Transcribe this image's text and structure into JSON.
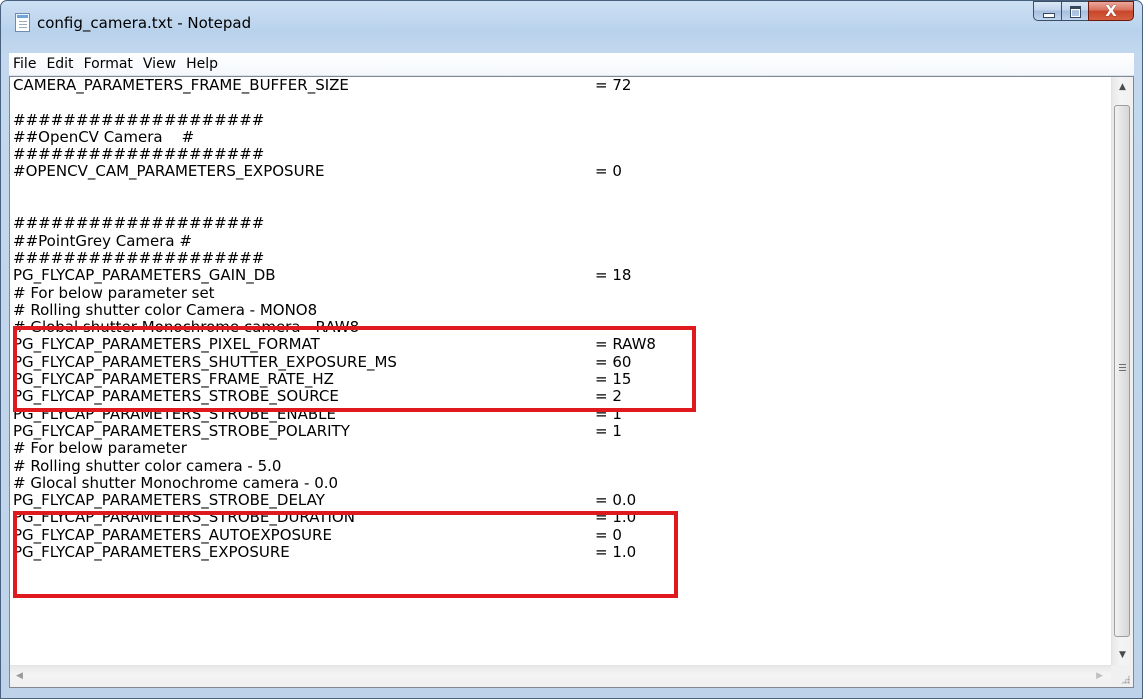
{
  "window": {
    "title": "config_camera.txt - Notepad",
    "close_glyph": "X",
    "accent": "#e0191f"
  },
  "menu": [
    "File",
    "Edit",
    "Format",
    "View",
    "Help"
  ],
  "lines": [
    {
      "key": "CAMERA_PARAMETERS_FRAME_BUFFER_SIZE",
      "val": "= 72"
    },
    {
      "key": "",
      "val": ""
    },
    {
      "key": "####################",
      "val": ""
    },
    {
      "key": "##OpenCV Camera    #",
      "val": ""
    },
    {
      "key": "####################",
      "val": ""
    },
    {
      "key": "#OPENCV_CAM_PARAMETERS_EXPOSURE",
      "val": "= 0"
    },
    {
      "key": "",
      "val": ""
    },
    {
      "key": "",
      "val": ""
    },
    {
      "key": "####################",
      "val": ""
    },
    {
      "key": "##PointGrey Camera #",
      "val": ""
    },
    {
      "key": "####################",
      "val": ""
    },
    {
      "key": "PG_FLYCAP_PARAMETERS_GAIN_DB",
      "val": "= 18"
    },
    {
      "key": "# For below parameter set",
      "val": ""
    },
    {
      "key": "# Rolling shutter color Camera - MONO8",
      "val": ""
    },
    {
      "key": "# Global shutter Monochrome camera - RAW8",
      "val": ""
    },
    {
      "key": "PG_FLYCAP_PARAMETERS_PIXEL_FORMAT",
      "val": "= RAW8"
    },
    {
      "key": "PG_FLYCAP_PARAMETERS_SHUTTER_EXPOSURE_MS",
      "val": "= 60"
    },
    {
      "key": "PG_FLYCAP_PARAMETERS_FRAME_RATE_HZ",
      "val": "= 15"
    },
    {
      "key": "PG_FLYCAP_PARAMETERS_STROBE_SOURCE",
      "val": "= 2"
    },
    {
      "key": "PG_FLYCAP_PARAMETERS_STROBE_ENABLE",
      "val": "= 1"
    },
    {
      "key": "PG_FLYCAP_PARAMETERS_STROBE_POLARITY",
      "val": "= 1"
    },
    {
      "key": "# For below parameter",
      "val": ""
    },
    {
      "key": "# Rolling shutter color camera - 5.0",
      "val": ""
    },
    {
      "key": "# Glocal shutter Monochrome camera - 0.0",
      "val": ""
    },
    {
      "key": "PG_FLYCAP_PARAMETERS_STROBE_DELAY",
      "val": "= 0.0"
    },
    {
      "key": "PG_FLYCAP_PARAMETERS_STROBE_DURATION",
      "val": "= 1.0"
    },
    {
      "key": "PG_FLYCAP_PARAMETERS_AUTOEXPOSURE",
      "val": "= 0"
    },
    {
      "key": "PG_FLYCAP_PARAMETERS_EXPOSURE",
      "val": "= 1.0"
    }
  ]
}
